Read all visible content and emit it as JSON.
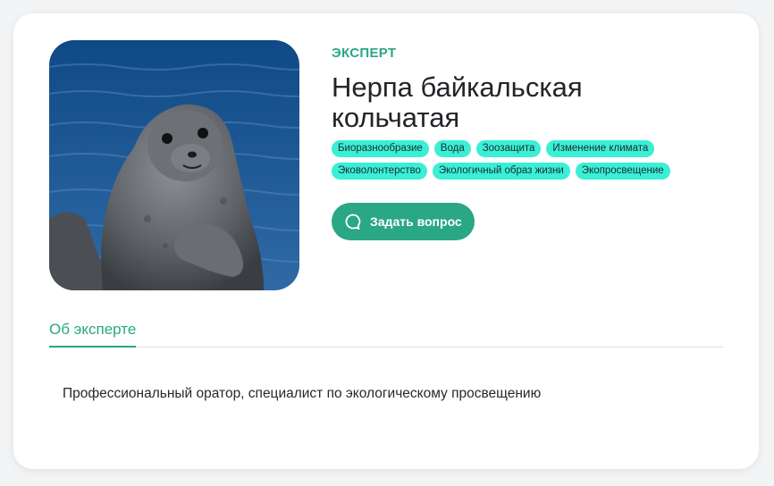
{
  "profile": {
    "role": "ЭКСПЕРТ",
    "name": "Нерпа байкальская кольчатая",
    "photo_icon": "seal-photo",
    "tags": [
      "Биоразнообразие",
      "Вода",
      "Зоозащита",
      "Изменение климата",
      "Эковолонтерство",
      "Экологичный образ жизни",
      "Экопросвещение"
    ],
    "ask_button": {
      "label": "Задать вопрос",
      "icon": "chat-bubble-icon"
    }
  },
  "tabs": [
    {
      "label": "Об эксперте",
      "active": true
    }
  ],
  "about": {
    "text": "Профессиональный оратор, специалист по экологическому просвещению"
  },
  "colors": {
    "accent": "#2aa784",
    "tag_bg": "#39efd6",
    "card_bg": "#ffffff",
    "page_bg": "#f3f4f6"
  }
}
